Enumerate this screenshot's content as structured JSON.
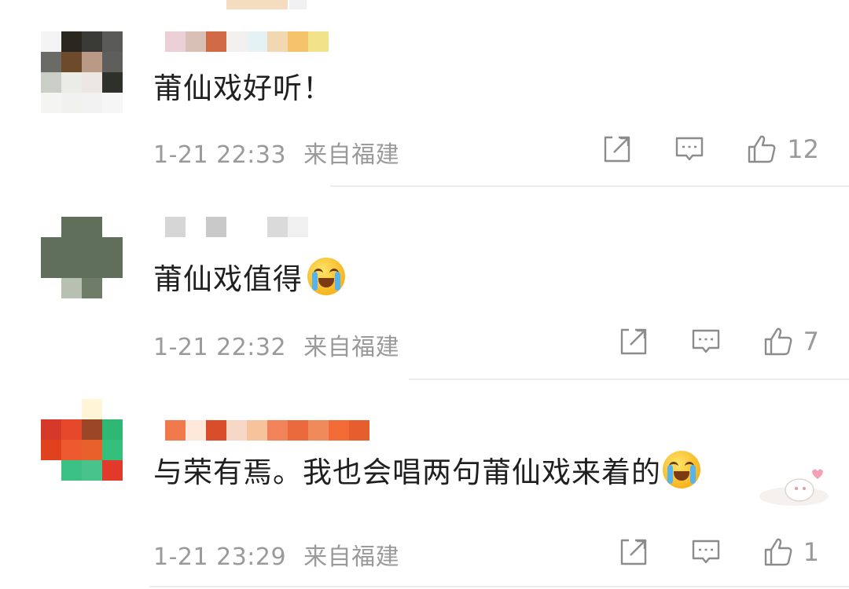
{
  "comments": [
    {
      "content": "莆仙戏好听！",
      "time": "1-21 22:33",
      "location": "来自福建",
      "likes": "12",
      "has_emoji": false
    },
    {
      "content": "莆仙戏值得",
      "time": "1-21 22:32",
      "location": "来自福建",
      "likes": "7",
      "has_emoji": true,
      "emoji_icon": "crying-face-icon"
    },
    {
      "content": "与荣有焉。我也会唱两句莆仙戏来着的",
      "time": "1-21 23:29",
      "location": "来自福建",
      "likes": "1",
      "has_emoji": true,
      "emoji_icon": "laugh-crying-face-icon"
    }
  ],
  "colors": {
    "meta_text": "#9a9a9a",
    "content_text": "#1f1f1f",
    "divider": "#ececec",
    "icon_stroke": "#8c8c8c"
  }
}
